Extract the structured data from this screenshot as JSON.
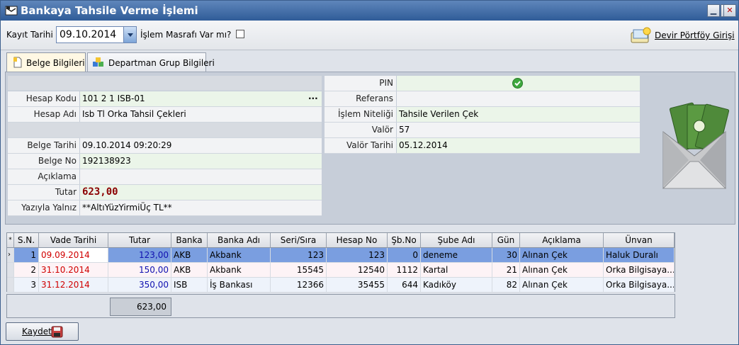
{
  "window": {
    "title": "Bankaya Tahsile Verme İşlemi"
  },
  "toolbar": {
    "kayit_tarihi_label": "Kayıt Tarihi",
    "kayit_tarihi_value": "09.10.2014",
    "masraf_label": "İşlem Masrafı Var mı?",
    "devir_label": "Devir Pörtföy Girişi"
  },
  "tabs": [
    {
      "label": "Belge Bilgileri"
    },
    {
      "label": "Departman Grup Bilgileri"
    }
  ],
  "left_fields": {
    "hesap_kodu": {
      "label": "Hesap Kodu",
      "value": "101 2 1 ISB-01",
      "button": "..."
    },
    "hesap_adi": {
      "label": "Hesap Adı",
      "value": "Isb Tl Orka Tahsil Çekleri"
    },
    "belge_tarihi": {
      "label": "Belge Tarihi",
      "value": "09.10.2014 09:20:29"
    },
    "belge_no": {
      "label": "Belge No",
      "value": "192138923"
    },
    "aciklama": {
      "label": "Açıklama",
      "value": ""
    },
    "tutar": {
      "label": "Tutar",
      "value": "623,00"
    },
    "yaziyla": {
      "label": "Yazıyla Yalnız",
      "value": "**AltıYüzYirmiÜç TL**"
    }
  },
  "right_fields": {
    "pin": {
      "label": "PIN"
    },
    "referans": {
      "label": "Referans",
      "value": ""
    },
    "islem_niteligi": {
      "label": "İşlem Niteliği",
      "value": "Tahsile Verilen Çek"
    },
    "valor": {
      "label": "Valör",
      "value": "57"
    },
    "valor_tarihi": {
      "label": "Valör Tarihi",
      "value": "05.12.2014"
    }
  },
  "grid": {
    "columns": [
      "S.N.",
      "Vade Tarihi",
      "Tutar",
      "Banka",
      "Banka Adı",
      "Seri/Sıra",
      "Hesap No",
      "Şb.No",
      "Şube Adı",
      "Gün",
      "Açıklama",
      "Ünvan"
    ],
    "rows": [
      {
        "sn": "1",
        "vade": "09.09.2014",
        "tutar": "123,00",
        "banka": "AKB",
        "banka_adi": "Akbank",
        "seri": "123",
        "hesap": "123",
        "sb": "0",
        "sube": "deneme",
        "gun": "30",
        "aciklama": "Alınan Çek",
        "unvan": "Haluk Duralı"
      },
      {
        "sn": "2",
        "vade": "31.10.2014",
        "tutar": "150,00",
        "banka": "AKB",
        "banka_adi": "Akbank",
        "seri": "15545",
        "hesap": "12540",
        "sb": "1112",
        "sube": "Kartal",
        "gun": "21",
        "aciklama": "Alınan Çek",
        "unvan": "Orka Bilgisaya..."
      },
      {
        "sn": "3",
        "vade": "31.12.2014",
        "tutar": "350,00",
        "banka": "ISB",
        "banka_adi": "İş Bankası",
        "seri": "12366",
        "hesap": "35455",
        "sb": "644",
        "sube": "Kadıköy",
        "gun": "82",
        "aciklama": "Alınan Çek",
        "unvan": "Orka Bilgisaya..."
      }
    ],
    "total": "623,00"
  },
  "buttons": {
    "kaydet": "Kaydet"
  },
  "colors": {
    "title_bar": "#2f5c98",
    "selected_row": "#7a9ee0",
    "date_red": "#d00000",
    "amount_blue": "#1010b0",
    "tutar_value": "#8b0000"
  }
}
